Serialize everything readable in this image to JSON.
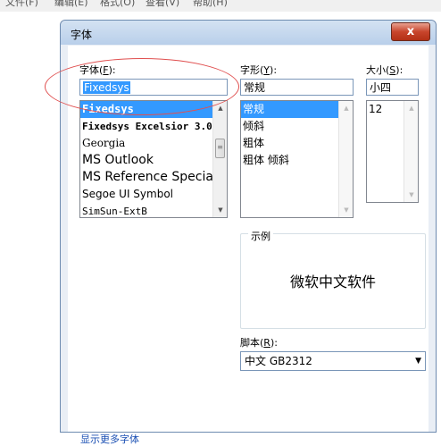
{
  "menubar": {
    "items": [
      "文件(F)",
      "编辑(E)",
      "格式(O)",
      "查看(V)",
      "帮助(H)"
    ]
  },
  "dialog": {
    "title": "字体",
    "close_label": "x"
  },
  "font": {
    "label_text": "字体(",
    "label_key": "F",
    "label_end": "):",
    "value": "Fixedsys",
    "items": [
      "Fixedsys",
      "Fixedsys Excelsior 3.0",
      "Georgia",
      "MS Outlook",
      "MS Reference Specialty",
      "Segoe UI Symbol",
      "SimSun-ExtB"
    ],
    "selected_index": 0
  },
  "style": {
    "label_text": "字形(",
    "label_key": "Y",
    "label_end": "):",
    "value": "常规",
    "items": [
      "常规",
      "倾斜",
      "粗体",
      "粗体 倾斜"
    ],
    "selected_index": 0
  },
  "size": {
    "label_text": "大小(",
    "label_key": "S",
    "label_end": "):",
    "value": "小四",
    "items": [
      "12"
    ]
  },
  "sample": {
    "legend": "示例",
    "text": "微软中文软件"
  },
  "script": {
    "label_text": "脚本(",
    "label_key": "R",
    "label_end": "):",
    "value": "中文 GB2312"
  },
  "more_fonts_link": "显示更多字体",
  "colors": {
    "selection": "#3399ff",
    "annotation": "#e05050",
    "close": "#c8452c"
  }
}
